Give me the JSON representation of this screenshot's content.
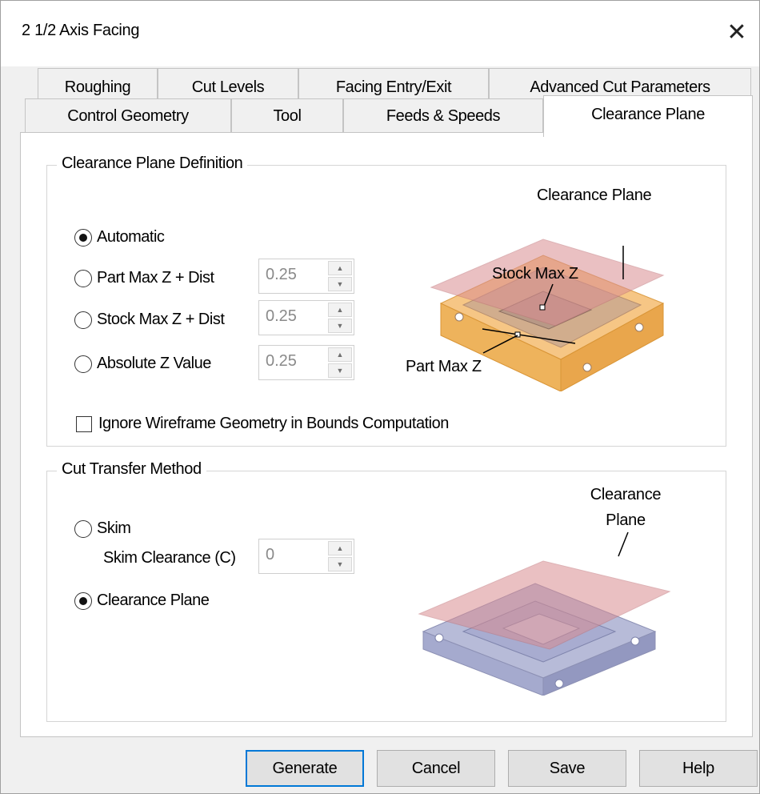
{
  "window": {
    "title": "2 1/2 Axis Facing",
    "close_glyph": "✕"
  },
  "tabs": {
    "row1": [
      "Roughing",
      "Cut Levels",
      "Facing Entry/Exit",
      "Advanced Cut Parameters"
    ],
    "row2": [
      "Control Geometry",
      "Tool",
      "Feeds & Speeds",
      "Clearance Plane"
    ],
    "active": "Clearance Plane"
  },
  "definition": {
    "title": "Clearance Plane Definition",
    "options": [
      {
        "label": "Automatic",
        "selected": true
      },
      {
        "label": "Part Max Z + Dist",
        "selected": false,
        "value": "0.25"
      },
      {
        "label": "Stock Max Z + Dist",
        "selected": false,
        "value": "0.25"
      },
      {
        "label": "Absolute Z Value",
        "selected": false,
        "value": "0.25"
      }
    ],
    "ignore_wireframe": {
      "label": "Ignore Wireframe Geometry in Bounds Computation",
      "checked": false
    },
    "illustration": {
      "clearance_plane": "Clearance Plane",
      "stock_max_z": "Stock Max Z",
      "part_max_z": "Part Max Z"
    }
  },
  "transfer": {
    "title": "Cut Transfer Method",
    "skim": {
      "label": "Skim",
      "selected": false
    },
    "skim_clearance": {
      "label": "Skim Clearance (C)",
      "value": "0"
    },
    "clearance_plane": {
      "label": "Clearance Plane",
      "selected": true
    },
    "illustration": {
      "label_line1": "Clearance",
      "label_line2": "Plane"
    }
  },
  "buttons": {
    "generate": "Generate",
    "cancel": "Cancel",
    "save": "Save",
    "help": "Help"
  },
  "colors": {
    "plane": "#d98d92",
    "stock": "#f4b860",
    "part_transfer": "#9aa0c8",
    "focus": "#0078d7"
  },
  "icons": {
    "close": "close-icon",
    "spin_up": "spin-up-icon",
    "spin_down": "spin-down-icon"
  }
}
